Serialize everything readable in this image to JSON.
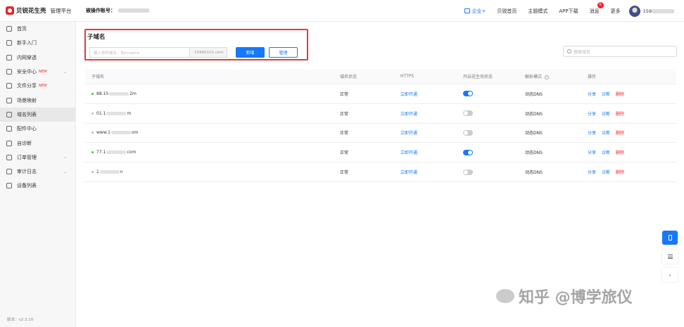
{
  "topbar": {
    "logo_text": "贝锐花生壳",
    "logo_sub": "管理平台",
    "account_label": "被操作账号：",
    "nav": {
      "enterprise": "企业+",
      "home": "贝锐首页",
      "theme": "主题模式",
      "app": "APP下载",
      "messages": "消息",
      "messages_badge": "5",
      "more": "更多"
    },
    "username_prefix": "159"
  },
  "sidebar": {
    "items": [
      {
        "label": "首页",
        "icon": "home-icon"
      },
      {
        "label": "新手入门",
        "icon": "bulb-icon"
      },
      {
        "label": "内网穿透",
        "icon": "cube-icon"
      },
      {
        "label": "安全中心",
        "icon": "shield-icon",
        "new": "NEW",
        "chevron": "⌄"
      },
      {
        "label": "文件分享",
        "icon": "folder-icon",
        "new": "NEW"
      },
      {
        "label": "场景映射",
        "icon": "scene-icon"
      },
      {
        "label": "域名列表",
        "icon": "list-icon"
      },
      {
        "label": "配件中心",
        "icon": "grid-icon"
      },
      {
        "label": "自诊断",
        "icon": "diagnose-icon"
      },
      {
        "label": "订单管理",
        "icon": "order-icon",
        "chevron": "⌄"
      },
      {
        "label": "审计日志",
        "icon": "log-icon",
        "chevron": "⌄"
      },
      {
        "label": "设备列表",
        "icon": "device-icon"
      }
    ],
    "version": "版本：v2.3.10"
  },
  "main": {
    "section_title": "子域名",
    "subdomain_input_placeholder": "输入你的域名、如mname",
    "suffix": ".15980101.com",
    "new_button": "新增",
    "manage_button": "管理",
    "search_placeholder": "搜索域名"
  },
  "table": {
    "headers": [
      "子域名",
      "域名状态",
      "HTTPS",
      "开启花生壳状态",
      "解析模式",
      "操作"
    ],
    "rows": [
      {
        "prefix": "88.15",
        "suffix": "2m",
        "status": "正常",
        "https": "立即开通",
        "enabled": true,
        "mode": "动态DNS"
      },
      {
        "prefix": "01.1",
        "suffix": "m",
        "status": "正常",
        "https": "立即开通",
        "enabled": false,
        "mode": "动态DNS"
      },
      {
        "prefix": "www.1",
        "suffix": "om",
        "status": "正常",
        "https": "立即开通",
        "enabled": false,
        "mode": "动态DNS"
      },
      {
        "prefix": "77.1",
        "suffix": "com",
        "status": "正常",
        "https": "立即开通",
        "enabled": true,
        "mode": "动态DNS"
      },
      {
        "prefix": "1",
        "suffix": "n",
        "status": "正常",
        "https": "立即开通",
        "enabled": false,
        "mode": "动态DNS"
      }
    ],
    "actions": {
      "share": "分享",
      "diagnose": "诊断",
      "delete": "删除"
    }
  },
  "watermark": "知乎 @博学旅仪",
  "colors": {
    "primary": "#1677ff",
    "danger": "#f5222d",
    "highlight_border": "#e03b3b",
    "online": "#52c41a"
  }
}
